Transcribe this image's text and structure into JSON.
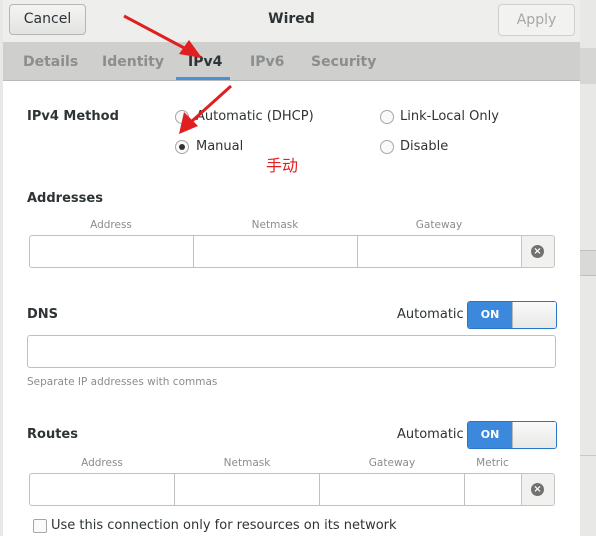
{
  "window": {
    "title": "Wired",
    "cancel_label": "Cancel",
    "apply_label": "Apply"
  },
  "tabs": [
    {
      "label": "Details",
      "active": false
    },
    {
      "label": "Identity",
      "active": false
    },
    {
      "label": "IPv4",
      "active": true
    },
    {
      "label": "IPv6",
      "active": false
    },
    {
      "label": "Security",
      "active": false
    }
  ],
  "ipv4_method": {
    "label": "IPv4 Method",
    "options": [
      {
        "label": "Automatic (DHCP)",
        "selected": false
      },
      {
        "label": "Link-Local Only",
        "selected": false
      },
      {
        "label": "Manual",
        "selected": true
      },
      {
        "label": "Disable",
        "selected": false
      }
    ]
  },
  "annotation": {
    "text": "手动",
    "color": "#e02020"
  },
  "addresses": {
    "label": "Addresses",
    "columns": [
      "Address",
      "Netmask",
      "Gateway"
    ],
    "rows": [
      [
        "",
        "",
        ""
      ]
    ]
  },
  "dns": {
    "label": "DNS",
    "automatic_label": "Automatic",
    "switch_label": "ON",
    "value": "",
    "hint": "Separate IP addresses with commas"
  },
  "routes": {
    "label": "Routes",
    "automatic_label": "Automatic",
    "switch_label": "ON",
    "columns": [
      "Address",
      "Netmask",
      "Gateway",
      "Metric"
    ],
    "rows": [
      [
        "",
        "",
        "",
        ""
      ]
    ]
  },
  "only_local": {
    "label": "Use this connection only for resources on its network",
    "checked": false
  },
  "colors": {
    "accent": "#4a90d9",
    "switch_on": "#3c88dc",
    "arrow": "#e02020"
  }
}
